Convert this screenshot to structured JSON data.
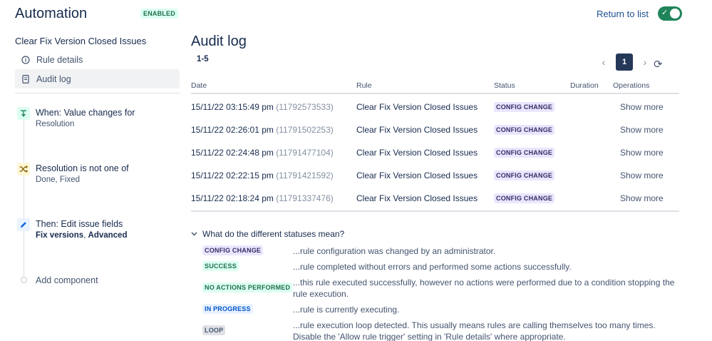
{
  "header": {
    "title": "Automation",
    "enabled_badge": "ENABLED",
    "return_link": "Return to list",
    "toggle_check": "✓"
  },
  "sidebar": {
    "rule_name": "Clear Fix Version Closed Issues",
    "nav": [
      {
        "label": "Rule details",
        "icon": "info-icon"
      },
      {
        "label": "Audit log",
        "icon": "document-icon",
        "active": true
      }
    ],
    "components": [
      {
        "title": "When: Value changes for",
        "subtitle": "Resolution",
        "icon": "trigger-icon",
        "color": "#1f845a",
        "bg": "#dcfff1"
      },
      {
        "title": "Resolution is not one of",
        "subtitle": "Done, Fixed",
        "icon": "shuffle-icon",
        "color": "#a54800",
        "bg": "#fff7d6"
      },
      {
        "title": "Then: Edit issue fields",
        "subtitle_a": "Fix versions",
        "subtitle_sep": ", ",
        "subtitle_b": "Advanced",
        "icon": "pencil-icon",
        "color": "#0c66e4",
        "bg": "#e9f2ff"
      }
    ],
    "add_component": "Add component"
  },
  "main": {
    "title": "Audit log",
    "range": "1-5",
    "pager": {
      "prev": "‹",
      "page": "1",
      "next": "›",
      "refresh": "⟳"
    },
    "columns": [
      "Date",
      "Rule",
      "Status",
      "Duration",
      "Operations"
    ],
    "rows": [
      {
        "date": "15/11/22 03:15:49 pm",
        "id": "(11792573533)",
        "rule": "Clear Fix Version Closed Issues",
        "status": "CONFIG CHANGE",
        "duration": "",
        "op": "Show more"
      },
      {
        "date": "15/11/22 02:26:01 pm",
        "id": "(11791502253)",
        "rule": "Clear Fix Version Closed Issues",
        "status": "CONFIG CHANGE",
        "duration": "",
        "op": "Show more"
      },
      {
        "date": "15/11/22 02:24:48 pm",
        "id": "(11791477104)",
        "rule": "Clear Fix Version Closed Issues",
        "status": "CONFIG CHANGE",
        "duration": "",
        "op": "Show more"
      },
      {
        "date": "15/11/22 02:22:15 pm",
        "id": "(11791421592)",
        "rule": "Clear Fix Version Closed Issues",
        "status": "CONFIG CHANGE",
        "duration": "",
        "op": "Show more"
      },
      {
        "date": "15/11/22 02:18:24 pm",
        "id": "(11791337476)",
        "rule": "Clear Fix Version Closed Issues",
        "status": "CONFIG CHANGE",
        "duration": "",
        "op": "Show more"
      }
    ],
    "legend": {
      "heading": "What do the different statuses mean?",
      "chevron": "⌄",
      "items": [
        {
          "status": "CONFIG CHANGE",
          "desc": "...rule configuration was changed by an administrator."
        },
        {
          "status": "SUCCESS",
          "desc": "...rule completed without errors and performed some actions successfully."
        },
        {
          "status": "NO ACTIONS PERFORMED",
          "desc": "...this rule executed successfully, however no actions were performed due to a condition stopping the rule execution."
        },
        {
          "status": "IN PROGRESS",
          "desc": "...rule is currently executing."
        },
        {
          "status": "LOOP",
          "desc": "...rule execution loop detected. This usually means rules are calling themselves too many times. Disable the 'Allow rule trigger' setting in 'Rule details' where appropriate."
        }
      ]
    }
  }
}
